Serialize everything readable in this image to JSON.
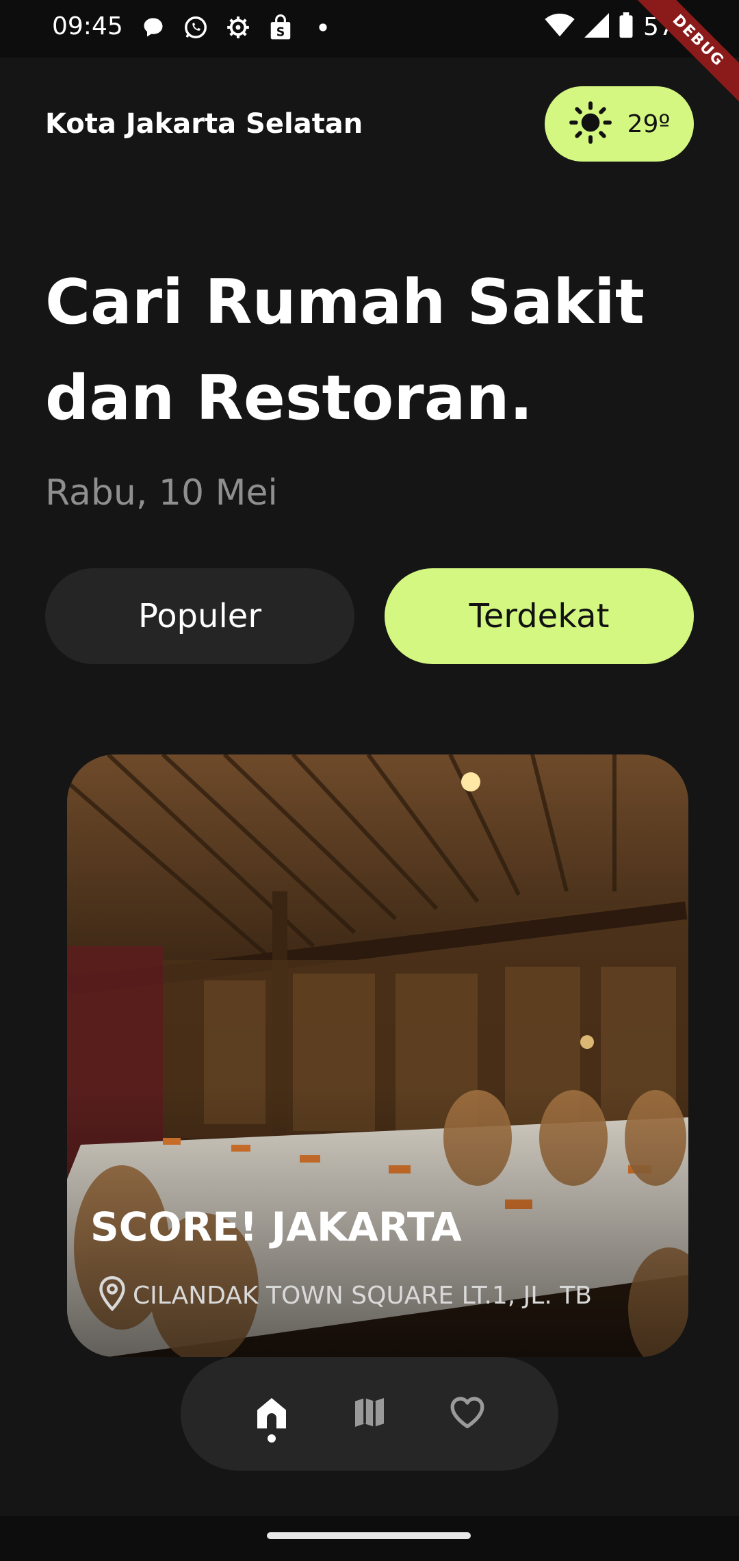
{
  "status_bar": {
    "time": "09:45",
    "battery": "57%",
    "debug_label": "DEBUG",
    "left_icons": [
      "chat-bubble-icon",
      "whatsapp-icon",
      "settings-icon",
      "shopping-bag-icon",
      "dot-icon"
    ],
    "right_icons": [
      "wifi-icon",
      "signal-icon",
      "battery-icon"
    ]
  },
  "header": {
    "location": "Kota Jakarta Selatan",
    "weather_temp": "29º",
    "weather_icon": "sun-icon"
  },
  "hero": {
    "headline_line1": "Cari Rumah Sakit",
    "headline_line2": "dan Restoran.",
    "date": "Rabu, 10 Mei"
  },
  "tabs": [
    {
      "label": "Populer",
      "active": false
    },
    {
      "label": "Terdekat",
      "active": true
    }
  ],
  "card": {
    "title": "SCORE! JAKARTA",
    "address": "CILANDAK TOWN SQUARE LT.1, JL. TB",
    "pin_icon": "location-pin-icon"
  },
  "bottom_nav": {
    "items": [
      {
        "icon": "home-icon",
        "active": true
      },
      {
        "icon": "map-icon",
        "active": false
      },
      {
        "icon": "heart-icon",
        "active": false
      }
    ]
  },
  "colors": {
    "accent": "#d4f782",
    "background": "#151515",
    "surface": "#252525",
    "muted_text": "#8f8f8f"
  }
}
